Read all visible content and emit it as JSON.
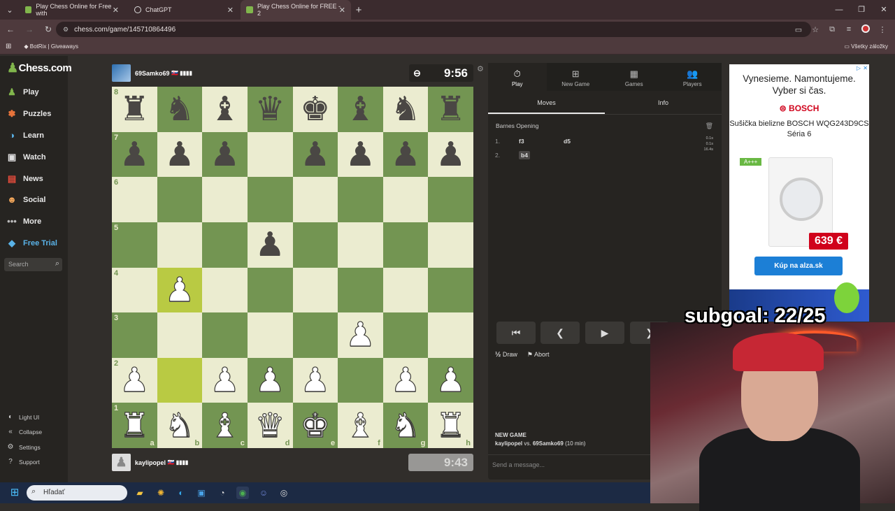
{
  "browser": {
    "tabs": [
      {
        "label": "Play Chess Online for Free with",
        "active": false
      },
      {
        "label": "ChatGPT",
        "active": false
      },
      {
        "label": "Play Chess Online for FREE - 2",
        "active": true
      }
    ],
    "url": "chess.com/game/145710864496",
    "bookmark": "BotRix | Giveaways",
    "all_bookmarks": "Všetky záložky"
  },
  "sidebar": {
    "logo": "Chess.com",
    "items": [
      {
        "label": "Play",
        "icon": "play-pawn-icon"
      },
      {
        "label": "Puzzles",
        "icon": "puzzle-icon"
      },
      {
        "label": "Learn",
        "icon": "learn-icon"
      },
      {
        "label": "Watch",
        "icon": "watch-icon"
      },
      {
        "label": "News",
        "icon": "news-icon"
      },
      {
        "label": "Social",
        "icon": "social-icon"
      },
      {
        "label": "More",
        "icon": "more-dots-icon"
      },
      {
        "label": "Free Trial",
        "icon": "diamond-icon"
      }
    ],
    "search_placeholder": "Search",
    "bottom": [
      {
        "label": "Light UI",
        "icon": "light-ui-icon"
      },
      {
        "label": "Collapse",
        "icon": "collapse-icon"
      },
      {
        "label": "Settings",
        "icon": "gear-icon"
      },
      {
        "label": "Support",
        "icon": "help-icon"
      }
    ]
  },
  "game": {
    "top_player": {
      "name": "69Samko69",
      "flag_rating": "🇸🇰 ▮▮▮▮",
      "clock": "9:56"
    },
    "bottom_player": {
      "name": "kaylipopel",
      "flag_rating": "🇸🇰 ▮▮▮▮",
      "clock": "9:43"
    },
    "board": [
      [
        "r",
        "n",
        "b",
        "q",
        "k",
        "b",
        "n",
        "r"
      ],
      [
        "p",
        "p",
        "p",
        "",
        "p",
        "p",
        "p",
        "p"
      ],
      [
        "",
        "",
        "",
        "",
        "",
        "",
        "",
        ""
      ],
      [
        "",
        "",
        "",
        "p",
        "",
        "",
        "",
        ""
      ],
      [
        "",
        "P",
        "",
        "",
        "",
        "",
        "",
        ""
      ],
      [
        "",
        "",
        "",
        "",
        "",
        "P",
        "",
        ""
      ],
      [
        "P",
        "",
        "P",
        "P",
        "P",
        "",
        "P",
        "P"
      ],
      [
        "R",
        "N",
        "B",
        "Q",
        "K",
        "B",
        "N",
        "R"
      ]
    ],
    "highlight_squares": [
      "b2",
      "b4"
    ],
    "ranks": [
      "8",
      "7",
      "6",
      "5",
      "4",
      "3",
      "2",
      "1"
    ],
    "files": [
      "a",
      "b",
      "c",
      "d",
      "e",
      "f",
      "g",
      "h"
    ],
    "colors": {
      "light": "#ebecd0",
      "dark": "#739552",
      "highlight_light": "#f5f682",
      "highlight_dark": "#b9ca43"
    }
  },
  "panel": {
    "tabs": [
      {
        "label": "Play",
        "icon": "stopwatch-icon"
      },
      {
        "label": "New Game",
        "icon": "plus-square-icon"
      },
      {
        "label": "Games",
        "icon": "board-icon"
      },
      {
        "label": "Players",
        "icon": "players-icon"
      }
    ],
    "subtabs": [
      "Moves",
      "Info"
    ],
    "opening": "Barnes Opening",
    "moves": [
      {
        "num": "1.",
        "white": "f3",
        "black": "d5"
      },
      {
        "num": "2.",
        "white": "b4",
        "black": ""
      }
    ],
    "time_notes": [
      "0.1s",
      "0.1s",
      "16.4s"
    ],
    "draw": "Draw",
    "abort": "Abort",
    "new_game_title": "NEW GAME",
    "new_game_white": "kaylipopel",
    "new_game_vs": "vs.",
    "new_game_black": "69Samko69",
    "new_game_tc": "(10 min)",
    "message_placeholder": "Send a message..."
  },
  "ad": {
    "headline": "Vynesieme. Namontujeme. Vyber si čas.",
    "brand": "BOSCH",
    "product": "Sušička bielizne BOSCH WQG243D9CS Séria 6",
    "energy": "A+++",
    "price": "639 €",
    "cta": "Kúp na alza.sk"
  },
  "overlay": {
    "subgoal": "subgoal: 22/25"
  },
  "taskbar": {
    "search": "Hľadať"
  }
}
